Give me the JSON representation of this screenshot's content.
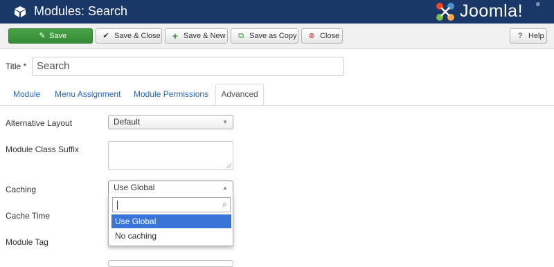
{
  "header": {
    "title": "Modules: Search",
    "logo_text": "Joomla!",
    "logo_reg": "®"
  },
  "toolbar": {
    "save": "Save",
    "save_close": "Save & Close",
    "save_new": "Save & New",
    "save_copy": "Save as Copy",
    "close": "Close",
    "help": "Help"
  },
  "form": {
    "title_label": "Title *",
    "title_value": "Search"
  },
  "tabs": [
    "Module",
    "Menu Assignment",
    "Module Permissions",
    "Advanced"
  ],
  "fields": {
    "alt_layout_label": "Alternative Layout",
    "alt_layout_value": "Default",
    "class_suffix_label": "Module Class Suffix",
    "caching_label": "Caching",
    "caching_value": "Use Global",
    "cache_time_label": "Cache Time",
    "module_tag_label": "Module Tag"
  },
  "caching_options": [
    "Use Global",
    "No caching"
  ],
  "colors": {
    "header_bg": "#1a3867",
    "save_green": "#46a546",
    "highlight": "#3875d7",
    "link": "#2a69b8"
  },
  "icons": [
    "cube-icon",
    "joomla-logo-icon",
    "pencil-square-icon",
    "check-icon",
    "plus-icon",
    "copy-icon",
    "close-circle-icon",
    "question-circle-icon",
    "search-icon",
    "dropdown-arrow-icon"
  ]
}
